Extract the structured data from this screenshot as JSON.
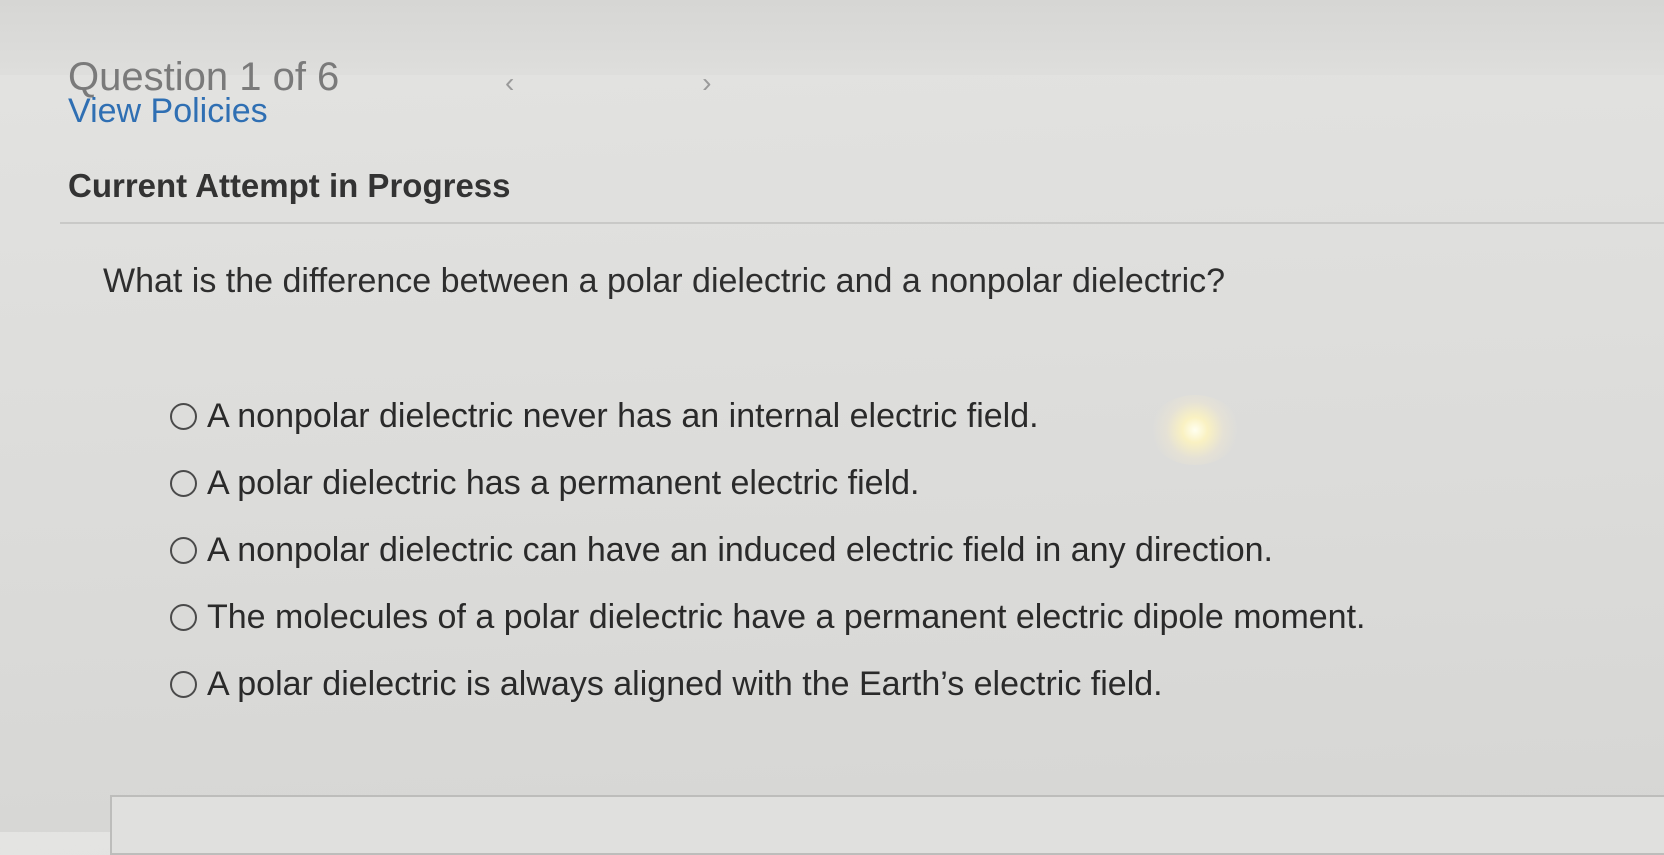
{
  "header": {
    "question_counter": "Question 1 of 6",
    "nav_arrows": "‹ ›"
  },
  "policies_link": "View Policies",
  "attempt_title": "Current Attempt in Progress",
  "question": {
    "text": "What is the difference between a polar dielectric and a nonpolar dielectric?",
    "options": [
      {
        "label": "A nonpolar dielectric never has an internal electric field.",
        "selected": false
      },
      {
        "label": "A polar dielectric has a permanent electric field.",
        "selected": false
      },
      {
        "label": "A nonpolar dielectric can have an induced electric field in any direction.",
        "selected": false
      },
      {
        "label": "The molecules of a polar dielectric have a permanent electric dipole moment.",
        "selected": false
      },
      {
        "label": "A polar dielectric is always aligned with the Earth’s electric field.",
        "selected": false
      }
    ]
  },
  "colors": {
    "link": "#2f6fb3",
    "text": "#2b2b2b",
    "background": "#dcdcda"
  }
}
